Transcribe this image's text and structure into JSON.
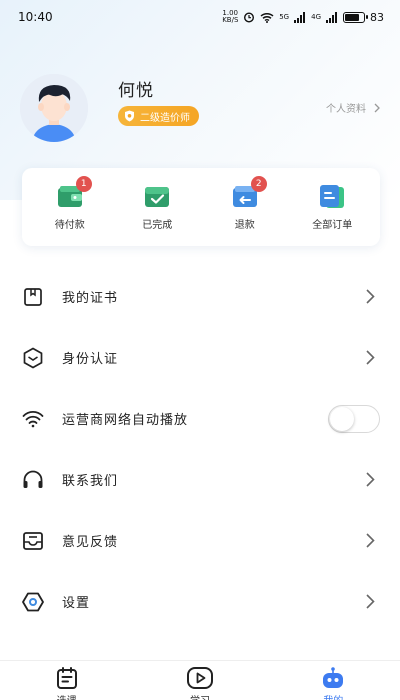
{
  "status_bar": {
    "time": "10:40",
    "net_speed": "1.00 KB/S",
    "signal_1": "5G",
    "signal_2": "4G",
    "battery": "83"
  },
  "profile": {
    "name": "何悦",
    "level_badge": "二级造价师",
    "profile_link": "个人资料"
  },
  "orders": [
    {
      "label": "待付款",
      "badge": "1",
      "color": "#2f9d6a",
      "icon": "wallet-icon"
    },
    {
      "label": "已完成",
      "badge": "",
      "color": "#2f9d6a",
      "icon": "completed-check-icon"
    },
    {
      "label": "退款",
      "badge": "2",
      "color": "#3f8be0",
      "icon": "refund-icon"
    },
    {
      "label": "全部订单",
      "badge": "",
      "color": "#3f8be0",
      "icon": "all-orders-icon"
    }
  ],
  "menu": [
    {
      "label": "我的证书",
      "icon": "certificate-icon",
      "type": "link"
    },
    {
      "label": "身份认证",
      "icon": "identity-icon",
      "type": "link"
    },
    {
      "label": "运营商网络自动播放",
      "icon": "wifi-icon",
      "type": "toggle",
      "value": false
    },
    {
      "label": "联系我们",
      "icon": "headphones-icon",
      "type": "link"
    },
    {
      "label": "意见反馈",
      "icon": "feedback-icon",
      "type": "link"
    },
    {
      "label": "设置",
      "icon": "settings-hex-icon",
      "type": "link"
    }
  ],
  "bottom_nav": [
    {
      "label": "选课",
      "icon": "calendar-icon",
      "active": false
    },
    {
      "label": "学习",
      "icon": "play-icon",
      "active": false
    },
    {
      "label": "我的",
      "icon": "robot-icon",
      "active": true
    }
  ],
  "colors": {
    "accent": "#3d7bf0",
    "badge_gold": "#f5a524",
    "green": "#2f9d6a",
    "blue": "#3f8be0",
    "badge_red": "#e2524f"
  }
}
